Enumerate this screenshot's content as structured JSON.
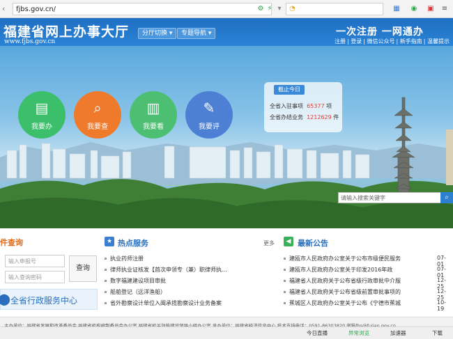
{
  "browser": {
    "url": "fjbs.gov.cn/",
    "status": [
      "今日直播",
      "异常浏览",
      "加速器",
      "下载"
    ]
  },
  "header": {
    "title": "福建省网上办事大厅",
    "url_text": "www.fjbs.gov.cn",
    "hall_switch": "分厅切换 ▾",
    "topic_nav": "专题导航 ▾",
    "slogan": "一次注册    一网通办",
    "links": [
      "注册",
      "登录",
      "微信公众号",
      "新手指南",
      "温馨提示"
    ]
  },
  "hero": {
    "buttons": [
      {
        "label": "我要办",
        "color": "#3bbf6a"
      },
      {
        "label": "我要查",
        "color": "#f07a2c"
      },
      {
        "label": "我要看",
        "color": "#4cbf73"
      },
      {
        "label": "我要评",
        "color": "#4d7fd4"
      }
    ],
    "stats": {
      "head": "截止今日",
      "row1_label": "全省入驻事项",
      "row1_value": "65377",
      "row1_unit": "项",
      "row2_label": "全省办结业务",
      "row2_value": "1212629",
      "row2_unit": "件"
    },
    "search_placeholder": "请输入搜索关键字"
  },
  "query": {
    "title": "件查询",
    "report_placeholder": "输入申报号",
    "password_placeholder": "输入查询密码",
    "button": "查询",
    "service_center": "全省行政服务中心"
  },
  "hot": {
    "title": "热点服务",
    "more": "更多",
    "items": [
      "执业药师注册",
      "律师执业证核发【首次申领专（兼）职律师执...",
      "数字福建建设项目审批",
      "船舶登记（远洋渔船）",
      "省外勘察设计单位入闽承揽勘察设计业务备案"
    ]
  },
  "news": {
    "title": "最新公告",
    "items": [
      {
        "text": "建瓯市人民政府办公室关于公布市级便民服务",
        "date": "07-01"
      },
      {
        "text": "建瓯市人民政府办公室关于印发2016年政",
        "date": "07-01"
      },
      {
        "text": "福建省人民政府关于公布省级行政审批中介服",
        "date": "12-25"
      },
      {
        "text": "福建省人民政府关于公布省级前置审批事项的",
        "date": "12-25"
      },
      {
        "text": "蕉城区人民政府办公室关于公布《宁德市蕉城",
        "date": "10-19"
      }
    ]
  },
  "footer": {
    "text": "主办单位：福建省发展和改革委员会 福建省机构编制委员会办公室 福建省机关效能建设领导小组办公室   承办单位：福建省经济信息中心   技术支持电话：0591-86303820 邮箱fbs@fujian.gov.cn"
  }
}
